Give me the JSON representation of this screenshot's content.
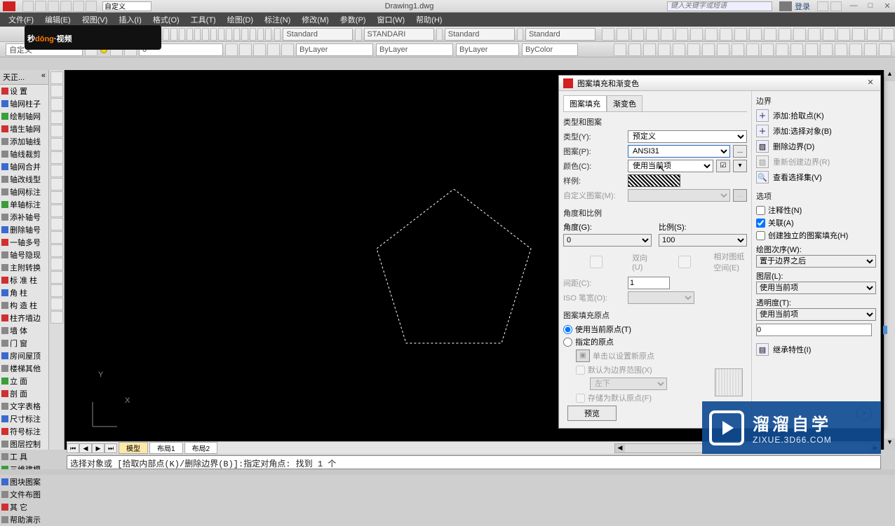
{
  "titlebar": {
    "context": "自定义",
    "doc_title": "Drawing1.dwg",
    "search_placeholder": "键入关键字或短语",
    "login": "登录"
  },
  "menubar": {
    "items": [
      "文件(F)",
      "编辑(E)",
      "视图(V)",
      "插入(I)",
      "格式(O)",
      "工具(T)",
      "绘图(D)",
      "标注(N)",
      "修改(M)",
      "参数(P)",
      "窗口(W)",
      "帮助(H)"
    ]
  },
  "logo": {
    "pre": "秒",
    "orange": "dǒng",
    "post": "·视频"
  },
  "tool_combos": {
    "style1": "Standard",
    "style2": "STANDARI",
    "style3": "Standard",
    "style4": "Standard"
  },
  "layer_row": {
    "context": "自定义",
    "layer_name": "0",
    "linetype1": "ByLayer",
    "linetype2": "ByLayer",
    "linetype3": "ByLayer",
    "color": "ByColor"
  },
  "side_title": "天正...",
  "side_items": [
    "设    置",
    "轴网柱子",
    "绘制轴网",
    "墙生轴网",
    "添加轴线",
    "轴线裁剪",
    "轴网合并",
    "轴改线型",
    "轴网标注",
    "单轴标注",
    "添补轴号",
    "删除轴号",
    "一轴多号",
    "轴号隐现",
    "主附转换",
    "标 准 柱",
    "角    柱",
    "构 造 柱",
    "柱齐墙边",
    "墙    体",
    "门    窗",
    "房间屋顶",
    "楼梯其他",
    "立    面",
    "剖    面",
    "文字表格",
    "尺寸标注",
    "符号标注",
    "图层控制",
    "工    具",
    "三维建模",
    "图块图案",
    "文件布图",
    "其    它",
    "帮助演示"
  ],
  "ucs": {
    "y": "Y",
    "x": "X"
  },
  "layout_tabs": {
    "model": "模型",
    "layout1": "布局1",
    "layout2": "布局2"
  },
  "cmdline": "选择对象或 [拾取内部点(K)/删除边界(B)]:指定对角点:  找到 1 个",
  "dialog": {
    "title": "图案填充和渐变色",
    "tab_hatch": "图案填充",
    "tab_gradient": "渐变色",
    "group_type": "类型和图案",
    "label_type": "类型(Y):",
    "val_type": "预定义",
    "label_pattern": "图案(P):",
    "val_pattern": "ANSI31",
    "label_color": "颜色(C):",
    "val_color": "使用当前项",
    "label_sample": "样例:",
    "label_custom": "自定义图案(M):",
    "group_angle": "角度和比例",
    "label_angle": "角度(G):",
    "val_angle": "0",
    "label_scale": "比例(S):",
    "val_scale": "100",
    "chk_double": "双向(U)",
    "chk_relscale": "相对图纸空间(E)",
    "label_spacing": "间距(C):",
    "val_spacing": "1",
    "label_isopen": "ISO 笔宽(O):",
    "group_origin": "图案填充原点",
    "radio_current": "使用当前原点(T)",
    "radio_spec": "指定的原点",
    "btn_click_origin": "单击以设置新原点",
    "chk_default_ext": "默认为边界范围(X)",
    "combo_pos": "左下",
    "chk_store": "存储为默认原点(F)",
    "btn_preview": "预览",
    "right_boundary": "边界",
    "btn_pick": "添加:拾取点(K)",
    "btn_select": "添加:选择对象(B)",
    "btn_remove": "删除边界(D)",
    "btn_recreate": "重新创建边界(R)",
    "btn_viewsel": "查看选择集(V)",
    "right_options": "选项",
    "chk_annotative": "注释性(N)",
    "chk_assoc": "关联(A)",
    "chk_separate": "创建独立的图案填充(H)",
    "label_draworder": "绘图次序(W):",
    "val_draworder": "置于边界之后",
    "label_layer": "图层(L):",
    "val_layer": "使用当前项",
    "label_transp": "透明度(T):",
    "val_transp": "使用当前项",
    "val_transp_num": "0",
    "btn_inherit": "继承特性(I)"
  },
  "watermark": {
    "big": "溜溜自学",
    "site": "ZIXUE.3D66.COM"
  }
}
